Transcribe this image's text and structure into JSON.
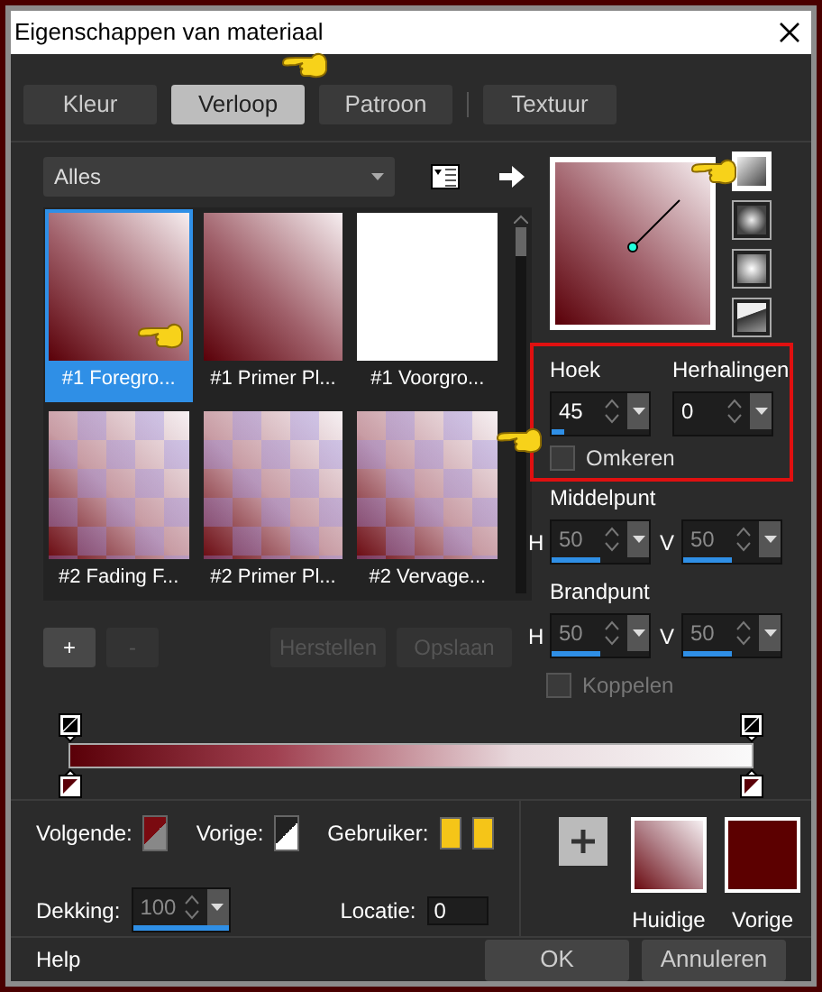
{
  "window": {
    "title": "Eigenschappen van materiaal"
  },
  "tabs": [
    {
      "label": "Kleur",
      "selected": false
    },
    {
      "label": "Verloop",
      "selected": true
    },
    {
      "label": "Patroon",
      "selected": false
    },
    {
      "label": "Textuur",
      "selected": false
    }
  ],
  "category_dropdown": {
    "value": "Alles"
  },
  "gradients": [
    {
      "label": "#1 Foregro...",
      "selected": true,
      "kind": "linear"
    },
    {
      "label": "#1 Primer Pl...",
      "selected": false,
      "kind": "linear"
    },
    {
      "label": "#1 Voorgro...",
      "selected": false,
      "kind": "blank"
    },
    {
      "label": "#2 Fading F...",
      "selected": false,
      "kind": "checker"
    },
    {
      "label": "#2 Primer Pl...",
      "selected": false,
      "kind": "checker"
    },
    {
      "label": "#2 Vervage...",
      "selected": false,
      "kind": "checker"
    }
  ],
  "list_buttons": [
    {
      "label": "+",
      "disabled": false
    },
    {
      "label": "-",
      "disabled": true
    },
    {
      "label": "Herstellen",
      "disabled": true
    },
    {
      "label": "Opslaan",
      "disabled": true
    }
  ],
  "style_buttons": [
    {
      "kind": "linear",
      "selected": true
    },
    {
      "kind": "rectangular",
      "selected": false
    },
    {
      "kind": "sunburst",
      "selected": false
    },
    {
      "kind": "radial",
      "selected": false
    }
  ],
  "angle": {
    "label": "Hoek",
    "value": "45",
    "level": 0.125
  },
  "repeats": {
    "label": "Herhalingen",
    "value": "0"
  },
  "invert": {
    "label": "Omkeren",
    "checked": false
  },
  "center": {
    "label": "Middelpunt",
    "h": {
      "label": "H",
      "value": "50",
      "level": 0.5,
      "disabled": true
    },
    "v": {
      "label": "V",
      "value": "50",
      "level": 0.5,
      "disabled": true
    }
  },
  "focal": {
    "label": "Brandpunt",
    "h": {
      "label": "H",
      "value": "50",
      "level": 0.5,
      "disabled": true
    },
    "v": {
      "label": "V",
      "value": "50",
      "level": 0.5,
      "disabled": true
    }
  },
  "link": {
    "label": "Koppelen",
    "checked": false,
    "disabled": true
  },
  "next": {
    "label": "Volgende:"
  },
  "previous": {
    "label": "Vorige:"
  },
  "user": {
    "label": "Gebruiker:"
  },
  "opacity": {
    "label": "Dekking:",
    "value": "100",
    "level": 1,
    "disabled": true
  },
  "location": {
    "label": "Locatie:",
    "value": "0"
  },
  "current_swatch": {
    "label": "Huidige"
  },
  "previous_swatch": {
    "label": "Vorige"
  },
  "footer": {
    "help": "Help",
    "ok": "OK",
    "cancel": "Annuleren"
  }
}
